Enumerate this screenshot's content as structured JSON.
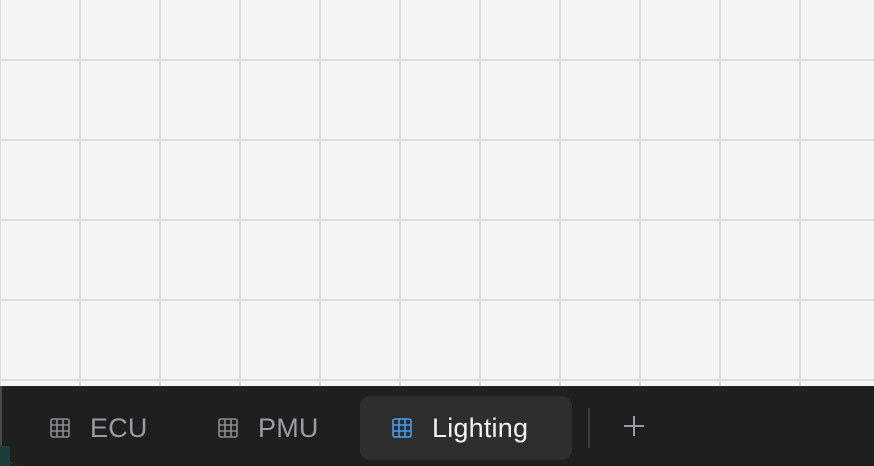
{
  "tabs": [
    {
      "label": "ECU",
      "active": false,
      "icon": "grid-icon"
    },
    {
      "label": "PMU",
      "active": false,
      "icon": "grid-icon"
    },
    {
      "label": "Lighting",
      "active": true,
      "icon": "grid-icon"
    }
  ],
  "add_tab": {
    "icon": "plus-icon"
  },
  "colors": {
    "canvas_bg": "#f4f4f4",
    "grid_line": "#dcdcdc",
    "tabbar_bg": "#1f1f1f",
    "active_tab_bg": "#2e2e2e",
    "active_icon": "#4a9cf5",
    "inactive_icon": "#8a8c93",
    "active_text": "#f2f2f2",
    "inactive_text": "#9a9ca3"
  }
}
